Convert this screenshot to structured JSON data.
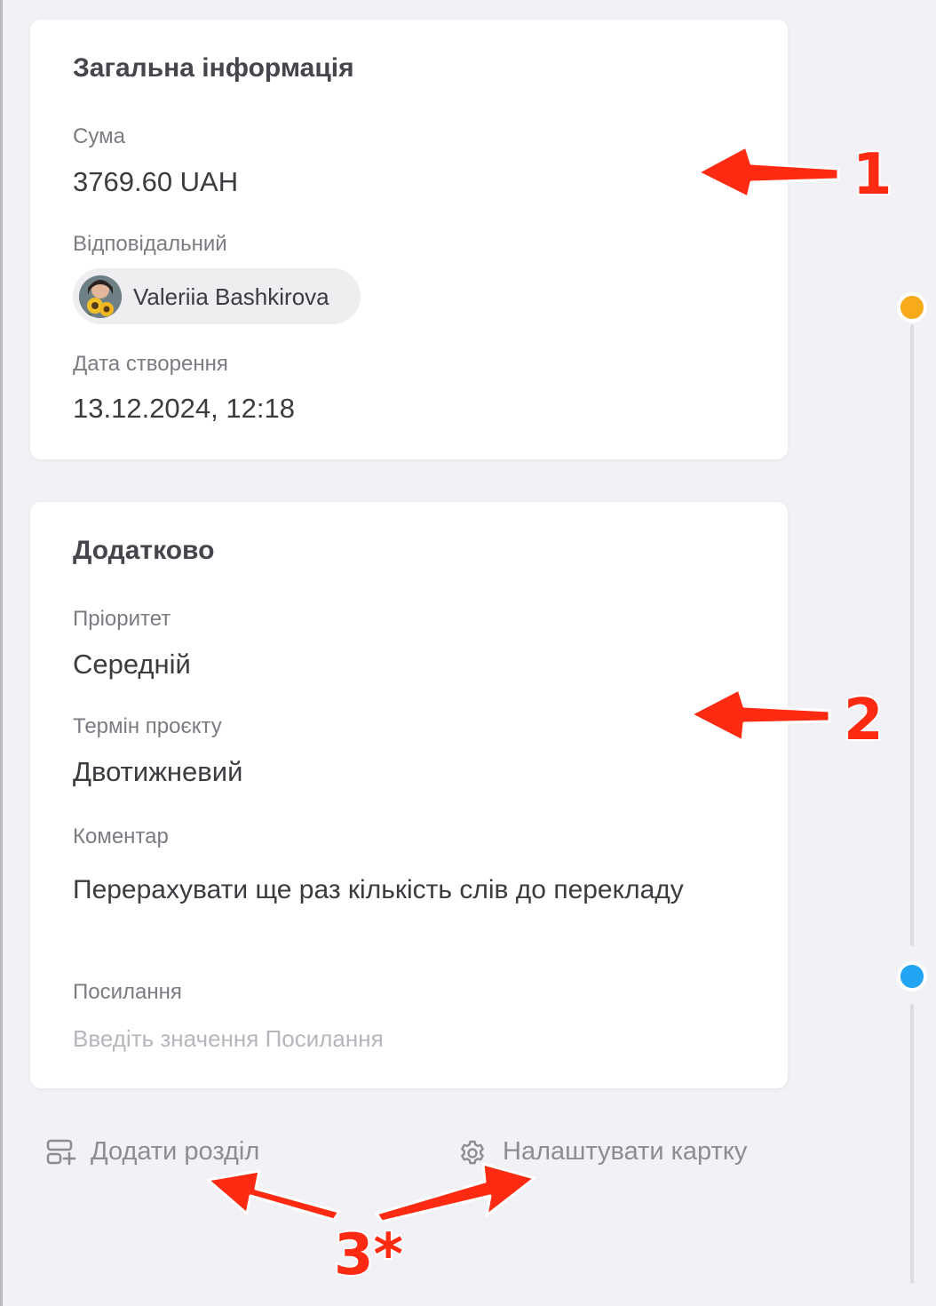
{
  "general": {
    "title": "Загальна інформація",
    "amount_label": "Сума",
    "amount_value": "3769.60 UAH",
    "responsible_label": "Відповідальний",
    "responsible_name": "Valeriia Bashkirova",
    "created_label": "Дата створення",
    "created_value": "13.12.2024, 12:18"
  },
  "extra": {
    "title": "Додатково",
    "priority_label": "Пріоритет",
    "priority_value": "Середній",
    "term_label": "Термін проєкту",
    "term_value": "Двотижневий",
    "comment_label": "Коментар",
    "comment_value": "Перерахувати ще раз кількість слів до перекладу",
    "link_label": "Посилання",
    "link_placeholder": "Введіть значення Посилання"
  },
  "actions": {
    "add_section": "Додати розділ",
    "customize_card": "Налаштувати картку"
  },
  "annotations": {
    "marker_1": "1",
    "marker_2": "2",
    "marker_3": "3*"
  },
  "colors": {
    "page_background": "#f2f2f6",
    "card_background": "#ffffff",
    "annotation_red": "#ff2a12",
    "timeline_orange": "#f7aa1b",
    "timeline_blue": "#21a4f2"
  },
  "icons": {
    "add_section": "add-section-icon",
    "customize": "gear-icon",
    "avatar": "user-avatar-photo"
  }
}
